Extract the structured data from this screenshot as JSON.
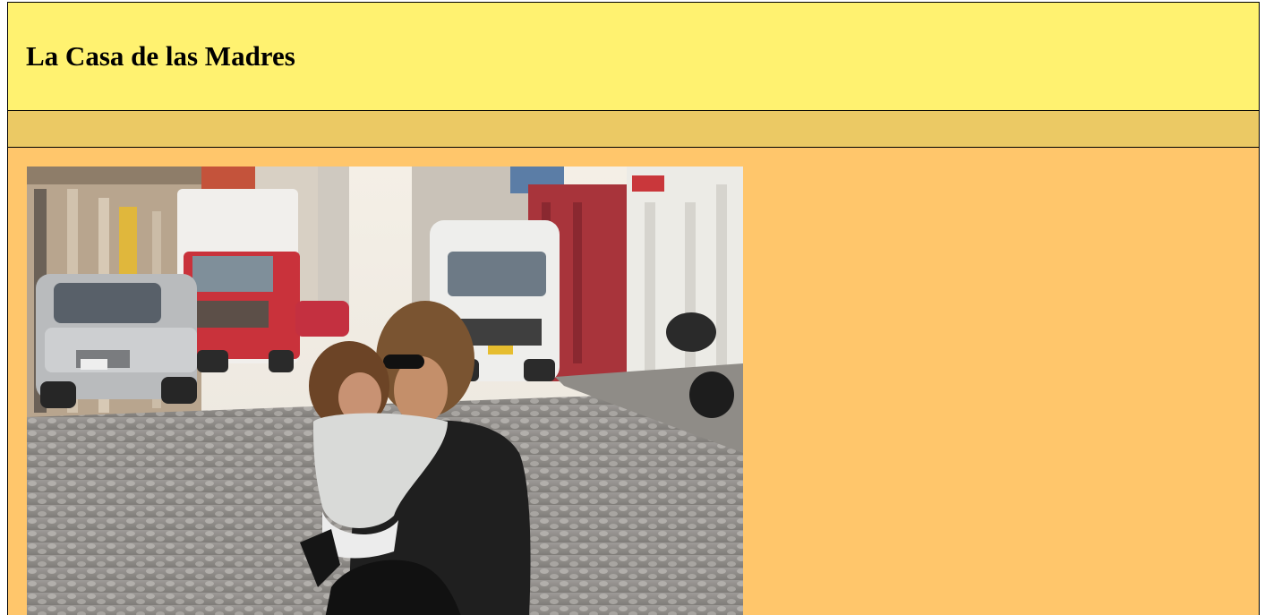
{
  "header": {
    "title": "La Casa de las Madres",
    "background": "#fff270"
  },
  "nav": {
    "background": "#ebc964"
  },
  "main": {
    "background": "#ffc66b"
  },
  "hero_image": {
    "subject": "mother and daughter photo"
  }
}
